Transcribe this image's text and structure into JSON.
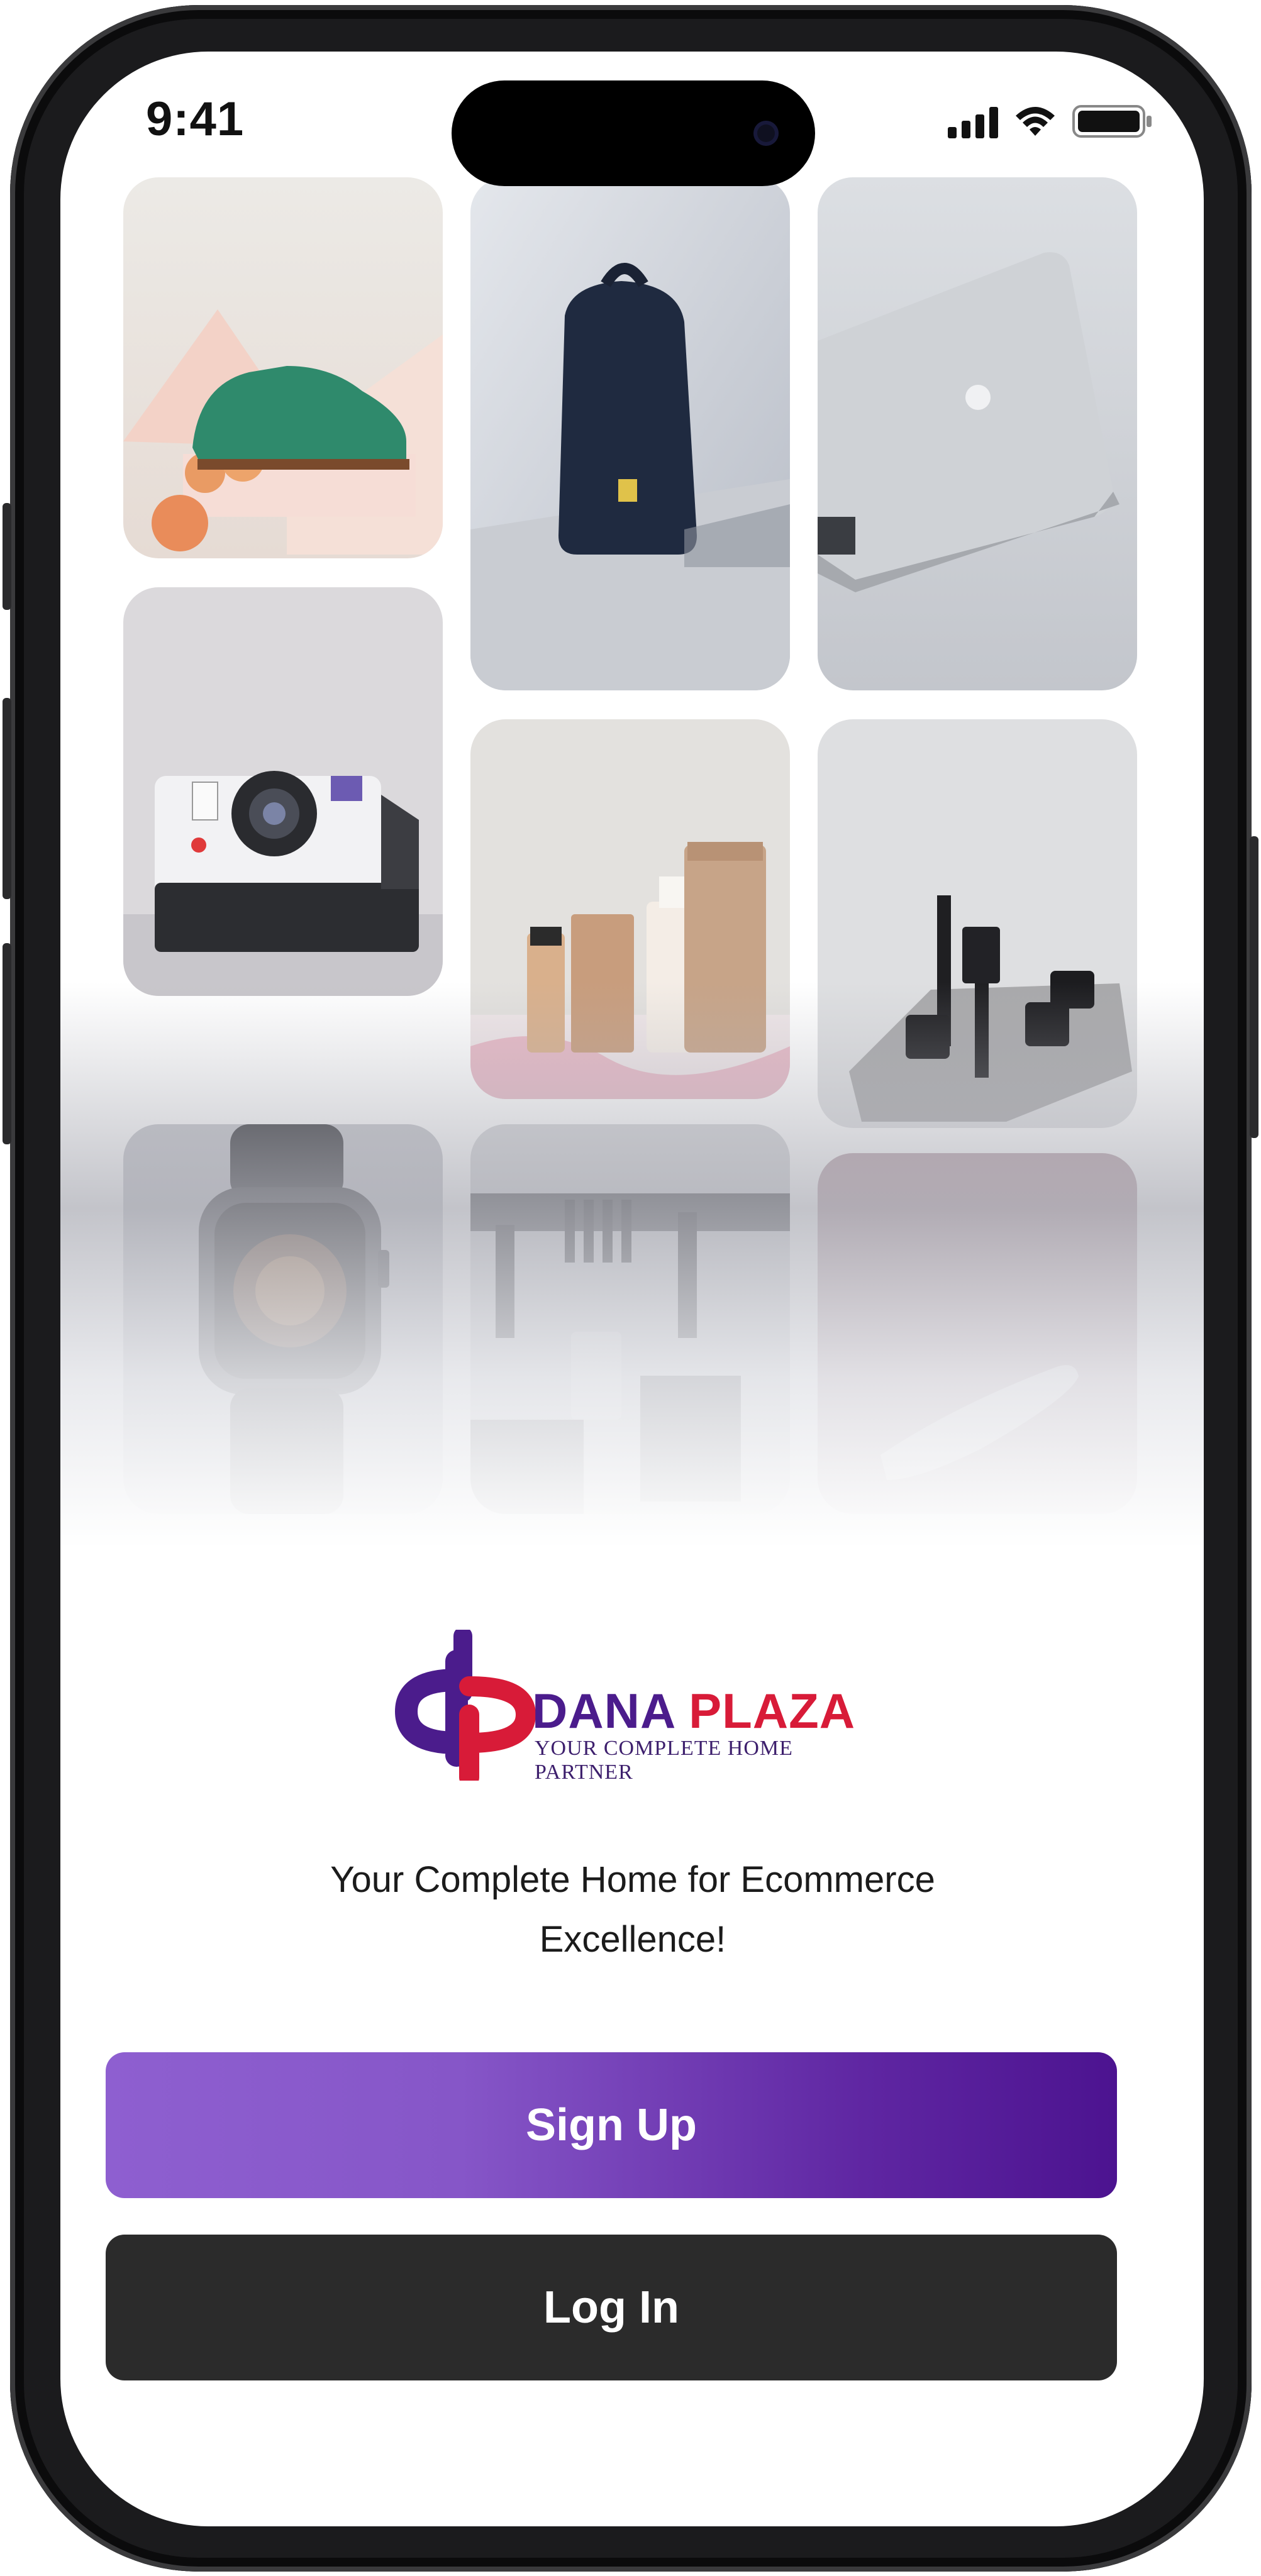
{
  "status_bar": {
    "time": "9:41"
  },
  "brand": {
    "name_part1": "DANA",
    "name_part2": "PLAZA",
    "tagline": "YOUR COMPLETE HOME PARTNER",
    "color_primary": "#4b1c8c",
    "color_secondary": "#d81b38"
  },
  "product_grid": {
    "items": [
      {
        "icon": "shoe-icon"
      },
      {
        "icon": "backpack-icon"
      },
      {
        "icon": "laptop-icon"
      },
      {
        "icon": "instant-camera-icon"
      },
      {
        "icon": "skincare-bottles-icon"
      },
      {
        "icon": "cosmetics-jars-icon"
      },
      {
        "icon": "smartwatch-icon"
      },
      {
        "icon": "perfume-display-icon"
      },
      {
        "icon": "hair-dryer-icon"
      }
    ]
  },
  "welcome": {
    "headline_line1": "Your Complete Home for Ecommerce",
    "headline_line2": "Excellence!"
  },
  "actions": {
    "signup_label": "Sign Up",
    "login_label": "Log In",
    "signup_color": "#6a2db3",
    "login_color": "#2b2b2b"
  }
}
